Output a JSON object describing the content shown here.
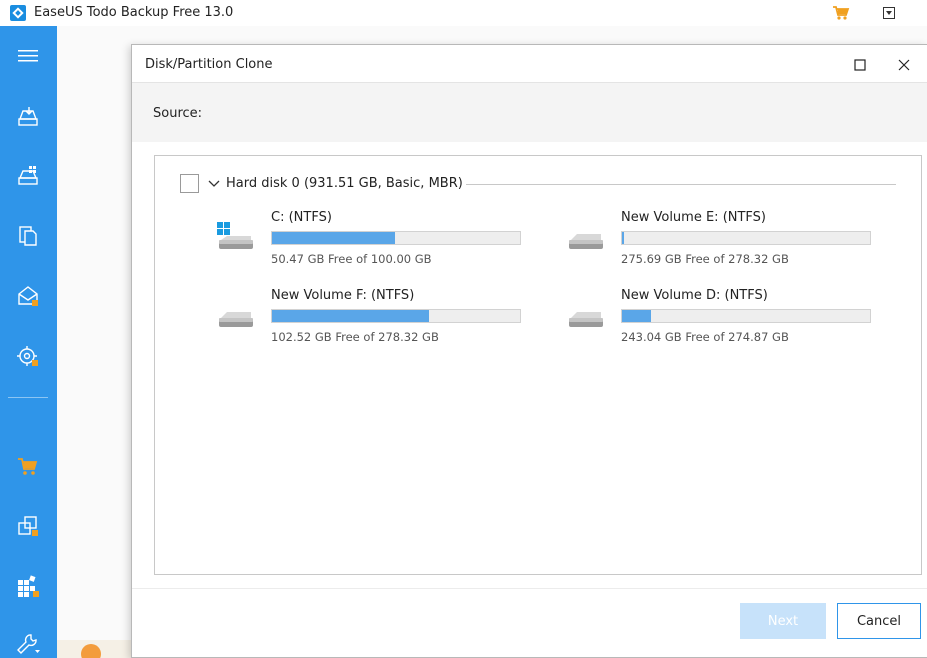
{
  "app": {
    "title": "EaseUS Todo Backup Free 13.0",
    "accent_color": "#2f95e9",
    "title_icons": [
      "cart-icon",
      "dropdown-menu-icon"
    ]
  },
  "sidebar": {
    "items": [
      {
        "icon": "hamburger-menu-icon"
      },
      {
        "icon": "disk-backup-icon"
      },
      {
        "icon": "system-backup-icon"
      },
      {
        "icon": "file-backup-icon"
      },
      {
        "icon": "mail-backup-icon"
      },
      {
        "icon": "smart-backup-icon"
      },
      {
        "icon": "cart-icon"
      },
      {
        "icon": "clone-icon"
      },
      {
        "icon": "tools-grid-icon"
      },
      {
        "icon": "wrench-icon"
      }
    ]
  },
  "dialog": {
    "title": "Disk/Partition Clone",
    "source_label": "Source:",
    "disk": {
      "title": "Hard disk 0 (931.51 GB, Basic, MBR)",
      "checked": false
    },
    "partitions": [
      {
        "name": "C: (NTFS)",
        "free_text": "50.47 GB Free of 100.00 GB",
        "used_fraction": 0.4953,
        "icon": "windows-drive-icon"
      },
      {
        "name": "New Volume E: (NTFS)",
        "free_text": "275.69 GB Free of 278.32 GB",
        "used_fraction": 0.0094,
        "icon": "drive-icon"
      },
      {
        "name": "New Volume F: (NTFS)",
        "free_text": "102.52 GB Free of 278.32 GB",
        "used_fraction": 0.6316,
        "icon": "drive-icon"
      },
      {
        "name": "New Volume D: (NTFS)",
        "free_text": "243.04 GB Free of 274.87 GB",
        "used_fraction": 0.1158,
        "icon": "drive-icon"
      }
    ],
    "buttons": {
      "next_label": "Next",
      "cancel_label": "Cancel"
    }
  }
}
